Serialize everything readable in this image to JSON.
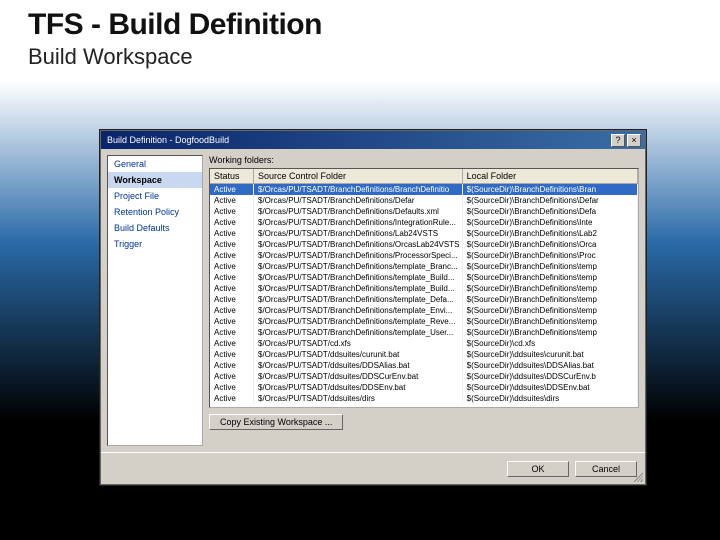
{
  "slide": {
    "title": "TFS - Build Definition",
    "subtitle": "Build Workspace"
  },
  "dialog": {
    "title": "Build Definition - DogfoodBuild",
    "help_glyph": "?",
    "close_glyph": "×",
    "sidebar": {
      "items": [
        {
          "label": "General",
          "selected": false
        },
        {
          "label": "Workspace",
          "selected": true
        },
        {
          "label": "Project File",
          "selected": false
        },
        {
          "label": "Retention Policy",
          "selected": false
        },
        {
          "label": "Build Defaults",
          "selected": false
        },
        {
          "label": "Trigger",
          "selected": false
        }
      ]
    },
    "main": {
      "working_folders_label": "Working folders:",
      "columns": {
        "status": "Status",
        "source": "Source Control Folder",
        "local": "Local Folder"
      },
      "rows": [
        {
          "status": "Active",
          "source": "$/Orcas/PU/TSADT/BranchDefinitions/BranchDefinitio",
          "local": "$(SourceDir)\\BranchDefinitions\\Bran",
          "selected": true
        },
        {
          "status": "Active",
          "source": "$/Orcas/PU/TSADT/BranchDefinitions/Defar",
          "local": "$(SourceDir)\\BranchDefinitions\\Defar"
        },
        {
          "status": "Active",
          "source": "$/Orcas/PU/TSADT/BranchDefinitions/Defaults.xml",
          "local": "$(SourceDir)\\BranchDefinitions\\Defa"
        },
        {
          "status": "Active",
          "source": "$/Orcas/PU/TSADT/BranchDefinitions/IntegrationRule...",
          "local": "$(SourceDir)\\BranchDefinitions\\Inte"
        },
        {
          "status": "Active",
          "source": "$/Orcas/PU/TSADT/BranchDefinitions/Lab24VSTS",
          "local": "$(SourceDir)\\BranchDefinitions\\Lab2"
        },
        {
          "status": "Active",
          "source": "$/Orcas/PU/TSADT/BranchDefinitions/OrcasLab24VSTS",
          "local": "$(SourceDir)\\BranchDefinitions\\Orca"
        },
        {
          "status": "Active",
          "source": "$/Orcas/PU/TSADT/BranchDefinitions/ProcessorSpeci...",
          "local": "$(SourceDir)\\BranchDefinitions\\Proc"
        },
        {
          "status": "Active",
          "source": "$/Orcas/PU/TSADT/BranchDefinitions/template_Branc...",
          "local": "$(SourceDir)\\BranchDefinitions\\temp"
        },
        {
          "status": "Active",
          "source": "$/Orcas/PU/TSADT/BranchDefinitions/template_Build...",
          "local": "$(SourceDir)\\BranchDefinitions\\temp"
        },
        {
          "status": "Active",
          "source": "$/Orcas/PU/TSADT/BranchDefinitions/template_Build...",
          "local": "$(SourceDir)\\BranchDefinitions\\temp"
        },
        {
          "status": "Active",
          "source": "$/Orcas/PU/TSADT/BranchDefinitions/template_Defa...",
          "local": "$(SourceDir)\\BranchDefinitions\\temp"
        },
        {
          "status": "Active",
          "source": "$/Orcas/PU/TSADT/BranchDefinitions/template_Envi...",
          "local": "$(SourceDir)\\BranchDefinitions\\temp"
        },
        {
          "status": "Active",
          "source": "$/Orcas/PU/TSADT/BranchDefinitions/template_Reve...",
          "local": "$(SourceDir)\\BranchDefinitions\\temp"
        },
        {
          "status": "Active",
          "source": "$/Orcas/PU/TSADT/BranchDefinitions/template_User...",
          "local": "$(SourceDir)\\BranchDefinitions\\temp"
        },
        {
          "status": "Active",
          "source": "$/Orcas/PU/TSADT/cd.xfs",
          "local": "$(SourceDir)\\cd.xfs"
        },
        {
          "status": "Active",
          "source": "$/Orcas/PU/TSADT/ddsuites/curunit.bat",
          "local": "$(SourceDir)\\ddsuites\\curunit.bat"
        },
        {
          "status": "Active",
          "source": "$/Orcas/PU/TSADT/ddsuites/DDSAlias.bat",
          "local": "$(SourceDir)\\ddsuites\\DDSAlias.bat"
        },
        {
          "status": "Active",
          "source": "$/Orcas/PU/TSADT/ddsuites/DDSCurEnv.bat",
          "local": "$(SourceDir)\\ddsuites\\DDSCurEnv.b"
        },
        {
          "status": "Active",
          "source": "$/Orcas/PU/TSADT/ddsuites/DDSEnv.bat",
          "local": "$(SourceDir)\\ddsuites\\DDSEnv.bat"
        },
        {
          "status": "Active",
          "source": "$/Orcas/PU/TSADT/ddsuites/dirs",
          "local": "$(SourceDir)\\ddsuites\\dirs"
        }
      ],
      "copy_button": "Copy Existing Workspace ..."
    },
    "footer": {
      "ok": "OK",
      "cancel": "Cancel"
    }
  }
}
